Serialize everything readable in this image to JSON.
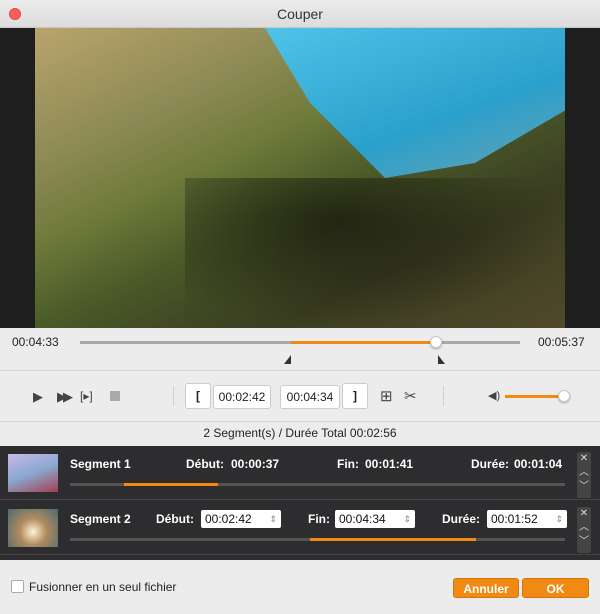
{
  "window": {
    "title": "Couper"
  },
  "player": {
    "current_time": "00:04:33",
    "total_time": "00:05:37",
    "selection_start_fraction": 0.48,
    "selection_end_fraction": 0.813,
    "playhead_fraction": 0.81,
    "volume_fraction": 0.95
  },
  "controls": {
    "start_time": "00:02:42",
    "end_time": "00:04:34",
    "set_start_label": "[",
    "set_end_label": "]"
  },
  "summary": "2 Segment(s) / Durée Total 00:02:56",
  "segments": [
    {
      "name": "Segment 1",
      "start_label": "Début:",
      "start": "00:00:37",
      "end_label": "Fin:",
      "end": "00:01:41",
      "duration_label": "Durée:",
      "duration": "00:01:04"
    },
    {
      "name": "Segment 2",
      "start_label": "Début:",
      "start": "00:02:42",
      "end_label": "Fin:",
      "end": "00:04:34",
      "duration_label": "Durée:",
      "duration": "00:01:52"
    }
  ],
  "footer": {
    "merge_label": "Fusionner en un seul fichier",
    "merge_checked": false,
    "cancel_label": "Annuler",
    "ok_label": "OK"
  },
  "colors": {
    "accent": "#f08a12",
    "segment_bg": "#2d2d2f"
  }
}
